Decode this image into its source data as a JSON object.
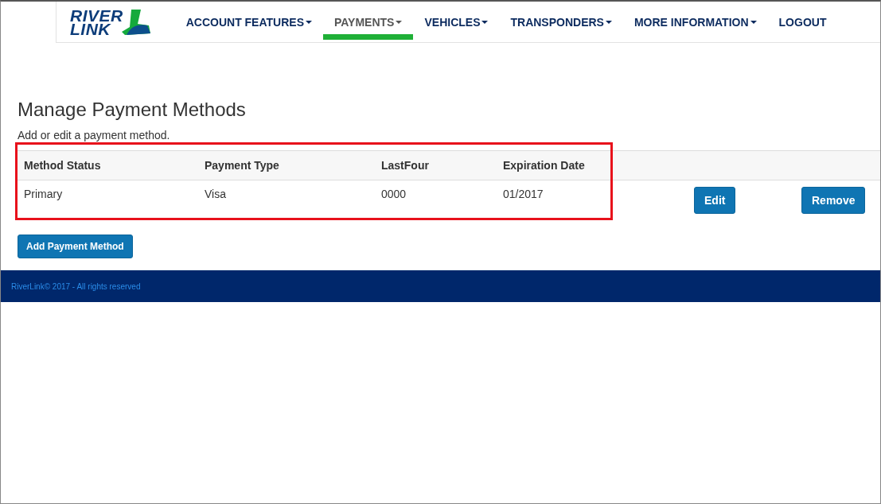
{
  "logo": {
    "line_1": "RIVER",
    "line_2": "LINK"
  },
  "nav": [
    {
      "label": "ACCOUNT FEATURES",
      "dropdown": true,
      "selected": false
    },
    {
      "label": "PAYMENTS",
      "dropdown": true,
      "selected": true
    },
    {
      "label": "VEHICLES",
      "dropdown": true,
      "selected": false
    },
    {
      "label": "TRANSPONDERS",
      "dropdown": true,
      "selected": false
    },
    {
      "label": "MORE INFORMATION",
      "dropdown": true,
      "selected": false
    },
    {
      "label": "LOGOUT",
      "dropdown": false,
      "selected": false
    }
  ],
  "page": {
    "title": "Manage Payment Methods",
    "subtitle": "Add or edit a payment method."
  },
  "table": {
    "columns": [
      "Method Status",
      "Payment Type",
      "LastFour",
      "Expiration Date"
    ],
    "rows": [
      {
        "cells": [
          "Primary",
          "Visa",
          "0000",
          "01/2017"
        ],
        "actions": [
          "Edit",
          "Remove"
        ]
      }
    ]
  },
  "add_button": "Add Payment Method",
  "footer": "RiverLink© 2017 - All rights reserved"
}
